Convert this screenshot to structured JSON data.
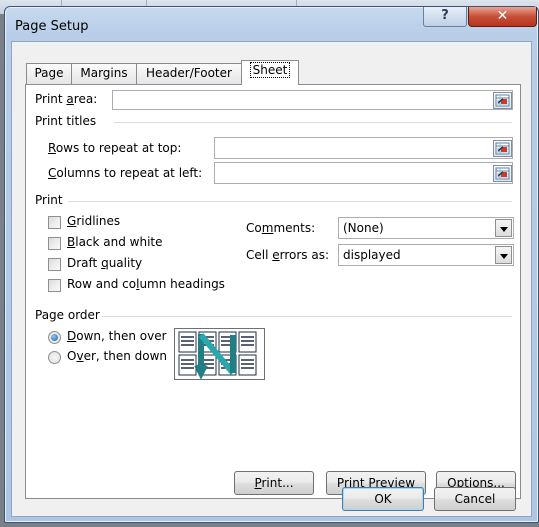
{
  "dialog": {
    "title": "Page Setup",
    "help_label": "?",
    "close_label": "✕"
  },
  "tabs": [
    {
      "label": "Page",
      "active": false
    },
    {
      "label": "Margins",
      "active": false
    },
    {
      "label": "Header/Footer",
      "active": false
    },
    {
      "label": "Sheet",
      "active": true
    }
  ],
  "print_area": {
    "label_pre": "Print ",
    "label_u": "a",
    "label_post": "rea:",
    "value": ""
  },
  "print_titles": {
    "heading": "Print titles",
    "rows": {
      "label_u": "R",
      "label_post": "ows to repeat at top:",
      "value": ""
    },
    "columns": {
      "label_u": "C",
      "label_post": "olumns to repeat at left:",
      "value": ""
    }
  },
  "print": {
    "heading": "Print",
    "gridlines": {
      "label_u": "G",
      "label_post": "ridlines",
      "checked": false
    },
    "black_white": {
      "label_u": "B",
      "label_post": "lack and white",
      "checked": false
    },
    "draft": {
      "label_pre": "Draft ",
      "label_u": "q",
      "label_post": "uality",
      "checked": false
    },
    "row_col_headings": {
      "label_pre": "Row and co",
      "label_u": "l",
      "label_post": "umn headings",
      "checked": false
    },
    "comments": {
      "label_pre": "Co",
      "label_u": "m",
      "label_post": "ments:",
      "value": "(None)"
    },
    "cell_errors": {
      "label_pre": "Cell ",
      "label_u": "e",
      "label_post": "rrors as:",
      "value": "displayed"
    }
  },
  "page_order": {
    "heading": "Page order",
    "down_then_over": {
      "label_u": "D",
      "label_post": "own, then over",
      "checked": true
    },
    "over_then_down": {
      "label_pre": "O",
      "label_u": "v",
      "label_post": "er, then down",
      "checked": false
    }
  },
  "buttons": {
    "print": {
      "label_u": "P",
      "label_post": "rint..."
    },
    "print_preview": {
      "label_pre": "Print Previe",
      "label_u": "w",
      "label_post": ""
    },
    "options": {
      "label_u": "O",
      "label_post": "ptions..."
    },
    "ok": "OK",
    "cancel": "Cancel"
  },
  "icons": {
    "reference": "collapse-dialog-range-icon",
    "page_order": "page-order-down-then-over-icon"
  }
}
